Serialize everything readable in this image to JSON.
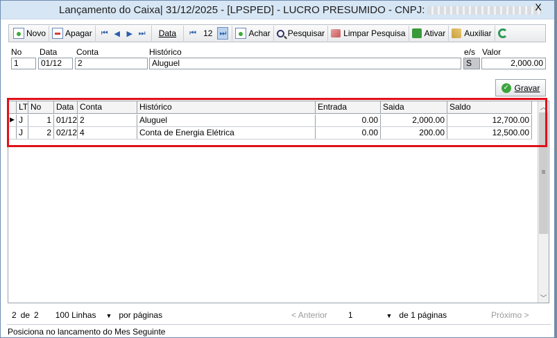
{
  "window": {
    "title": "Lançamento do Caixa|  31/12/2025 - [LPSPED] - LUCRO PRESUMIDO - CNPJ:",
    "close_label": "X"
  },
  "toolbar": {
    "novo": "Novo",
    "apagar": "Apagar",
    "data": "Data",
    "month": "12",
    "achar": "Achar",
    "pesquisar": "Pesquisar",
    "limpar": "Limpar Pesquisa",
    "ativar": "Ativar",
    "auxiliar": "Auxiliar"
  },
  "form": {
    "labels": {
      "no": "No",
      "data": "Data",
      "conta": "Conta",
      "historico": "Histórico",
      "es": "e/s",
      "valor": "Valor"
    },
    "values": {
      "no": "1",
      "data": "01/12",
      "conta": "2",
      "historico": "Aluguel",
      "es": "S",
      "valor": "2,000.00"
    }
  },
  "save_label": "Gravar",
  "grid": {
    "headers": [
      "LT",
      "No",
      "Data",
      "Conta",
      "Histórico",
      "Entrada",
      "Saida",
      "Saldo"
    ],
    "rows": [
      {
        "lt": "J",
        "no": "1",
        "data": "01/12",
        "conta": "2",
        "historico": "Aluguel",
        "entrada": "0.00",
        "saida": "2,000.00",
        "saldo": "12,700.00",
        "selected": true
      },
      {
        "lt": "J",
        "no": "2",
        "data": "02/12",
        "conta": "4",
        "historico": "Conta de Energia Elétrica",
        "entrada": "0.00",
        "saida": "200.00",
        "saldo": "12,500.00",
        "selected": false
      }
    ]
  },
  "footer": {
    "current": "2",
    "de": "de",
    "total": "2",
    "per_page": "100 Linhas",
    "por_paginas": "por páginas",
    "anterior": "Anterior",
    "page": "1",
    "de_paginas": "de 1 páginas",
    "proximo": "Próximo"
  },
  "status": "Posiciona no lancamento do Mes Seguinte",
  "colors": {
    "highlight": "#e0101a",
    "accent": "#2b5ea8"
  }
}
